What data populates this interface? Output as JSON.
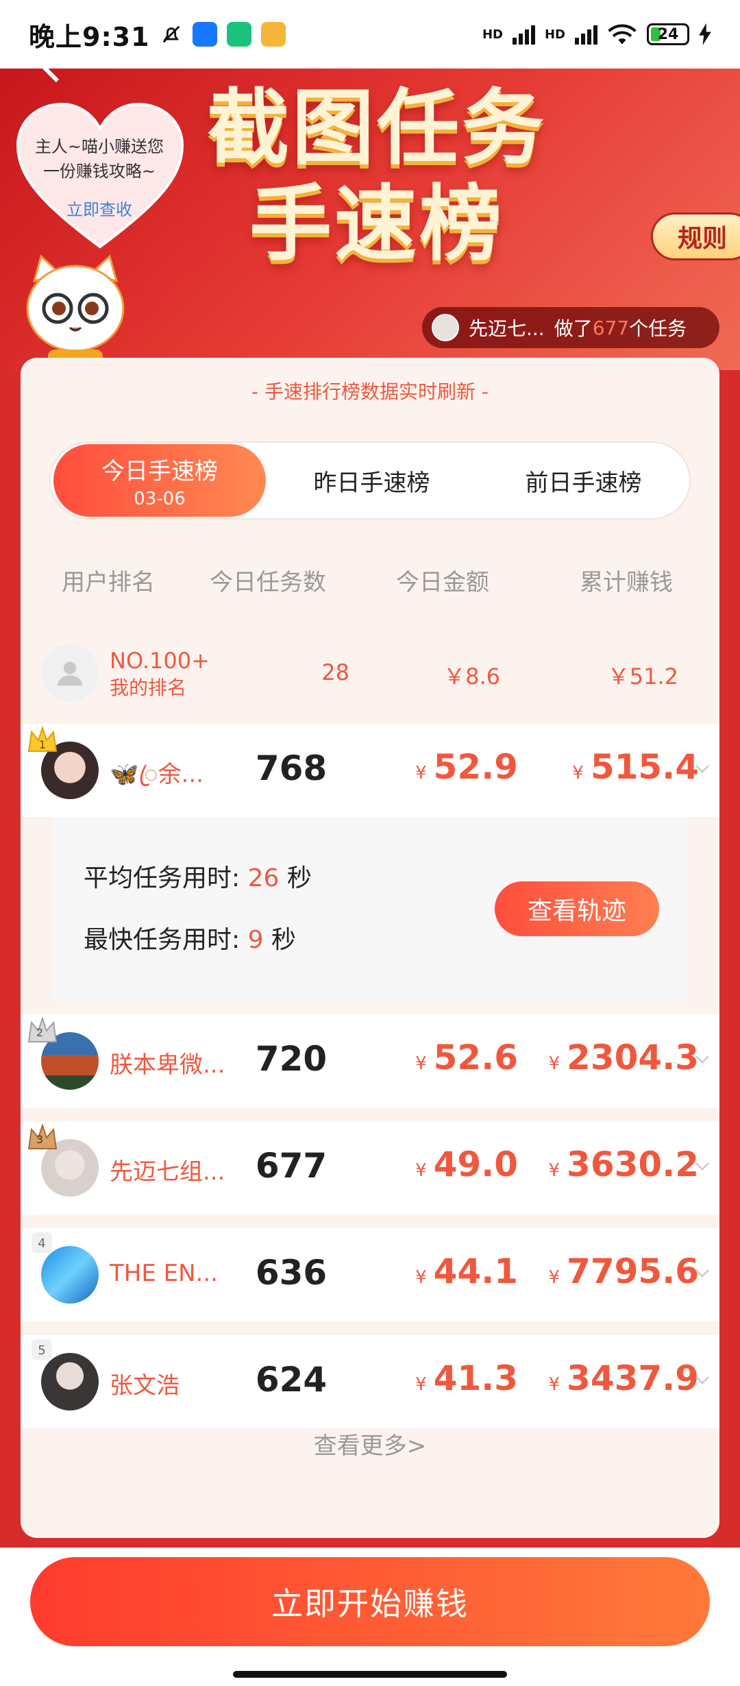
{
  "status_bar": {
    "time": "晚上9:31",
    "hd1": "HD",
    "hd2": "HD",
    "battery": "24"
  },
  "banner": {
    "title_line1": "截图任务",
    "title_line2": "手速榜",
    "heart_text_line1": "主人~喵小赚送您",
    "heart_text_line2": "一份赚钱攻略~",
    "heart_link": "立即查收",
    "rules_button": "规则",
    "ticker": {
      "name": "先迈七...",
      "prefix": "做了",
      "count": "677",
      "suffix": "个任务"
    }
  },
  "card": {
    "refresh_note": "- 手速排行榜数据实时刷新 -",
    "tabs": [
      {
        "label": "今日手速榜",
        "sub": "03-06"
      },
      {
        "label": "昨日手速榜"
      },
      {
        "label": "前日手速榜"
      }
    ],
    "columns": [
      "用户排名",
      "今日任务数",
      "今日金额",
      "累计赚钱"
    ],
    "my_rank": {
      "rank": "NO.100+",
      "label": "我的排名",
      "tasks": "28",
      "today": "￥8.6",
      "total": "￥51.2"
    },
    "currency_symbol": "¥",
    "rows": [
      {
        "rank": "1",
        "name": "🦋ꦿ余...",
        "tasks": "768",
        "today": "52.9",
        "total": "515.4"
      },
      {
        "rank": "2",
        "name": "朕本卑微...",
        "tasks": "720",
        "today": "52.6",
        "total": "2304.3"
      },
      {
        "rank": "3",
        "name": "先迈七组...",
        "tasks": "677",
        "today": "49.0",
        "total": "3630.2"
      },
      {
        "rank": "4",
        "name": "THE EN...",
        "tasks": "636",
        "today": "44.1",
        "total": "7795.6"
      },
      {
        "rank": "5",
        "name": "张文浩",
        "tasks": "624",
        "today": "41.3",
        "total": "3437.9"
      }
    ],
    "detail": {
      "avg_label": "平均任务用时:",
      "avg_value": "26",
      "fast_label": "最快任务用时:",
      "fast_value": "9",
      "unit": "秒",
      "track_button": "查看轨迹"
    },
    "more": "查看更多>"
  },
  "start_button": "立即开始赚钱",
  "colors": {
    "accent": "#f0583e",
    "banner_red": "#d72c2c",
    "gradient_start": "#ff4d3d",
    "gradient_end": "#ff8a52"
  }
}
